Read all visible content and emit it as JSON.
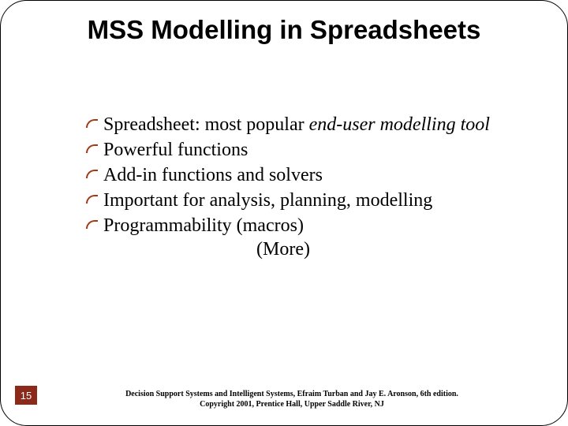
{
  "title": "MSS Modelling in Spreadsheets",
  "bullets": [
    {
      "plain": "Spreadsheet: most popular ",
      "em": "end-user modelling tool"
    },
    {
      "plain": "Powerful functions",
      "em": ""
    },
    {
      "plain": "Add-in functions and solvers",
      "em": ""
    },
    {
      "plain": "Important for analysis, planning, modelling",
      "em": ""
    },
    {
      "plain": "Programmability (macros)",
      "em": ""
    }
  ],
  "more": "(More)",
  "page_number": "15",
  "footer_line1": "Decision Support Systems and Intelligent Systems, Efraim Turban and Jay E. Aronson, 6th edition.",
  "footer_line2": "Copyright 2001, Prentice Hall, Upper Saddle River, NJ"
}
